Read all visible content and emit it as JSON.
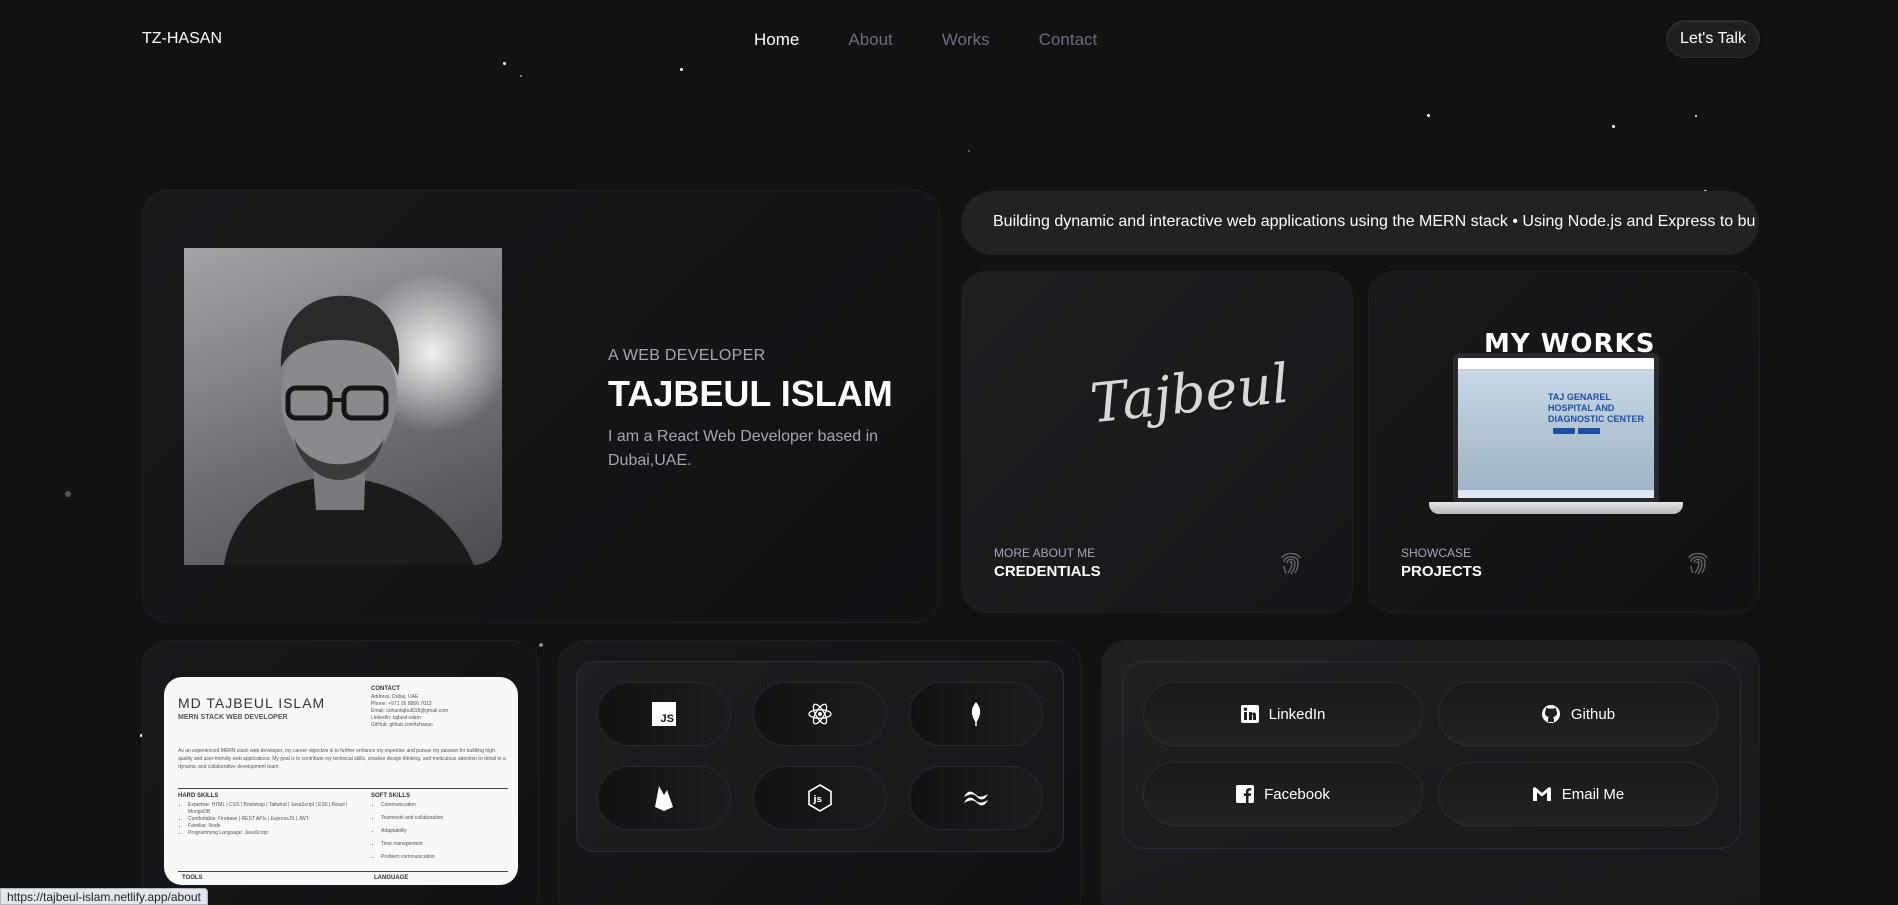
{
  "nav": {
    "logo": "TZ-HASAN",
    "items": [
      {
        "label": "Home",
        "active": true
      },
      {
        "label": "About",
        "active": false
      },
      {
        "label": "Works",
        "active": false
      },
      {
        "label": "Contact",
        "active": false
      }
    ],
    "cta": "Let's Talk"
  },
  "hero": {
    "subtitle": "A WEB DEVELOPER",
    "name": "TAJBEUL ISLAM",
    "description": "I am a React Web Developer based in Dubai,UAE."
  },
  "marquee": "Building dynamic and interactive web applications using the MERN stack • Using Node.js and Express to build e",
  "credentials": {
    "signature": "Tajbeul",
    "label": "MORE ABOUT ME",
    "title": "CREDENTIALS"
  },
  "projects": {
    "image_heading": "MY WORKS",
    "screen_text": "TAJ GENAREL HOSPITAL AND DIAGNOSTIC CENTER",
    "label": "SHOWCASE",
    "title": "PROJECTS"
  },
  "resume": {
    "name": "MD TAJBEUL ISLAM",
    "role": "MERN STACK WEB DEVELOPER",
    "contact_heading": "CONTACT",
    "contact_lines": [
      "Address: Dubai, UAE",
      "Phone: +971 05 8866 7013",
      "Email: sohantajbul018@gmail.com",
      "LinkedIn: tajbeul-islam",
      "GitHub: github.com/tzhasan"
    ],
    "summary": "As an experienced MERN stack web developer, my career objective is to further enhance my expertise and pursue my passion for building high-quality and user-friendly web applications. My goal is to contribute my technical skills, creative design thinking, and meticulous attention to detail to a dynamic and collaborative development team.",
    "hard_heading": "HARD SKILLS",
    "hard_skills": [
      "Expertise: HTML | CSS | Bootstrap | Tailwind | JavaScript | ES6 | React | MongoDB",
      "Comfortable: Firebase | REST APIs | ExpressJS | JWT",
      "Familiar: Node",
      "Programming Language: JavaScript"
    ],
    "soft_heading": "SOFT SKILLS",
    "soft_skills": [
      "Communication",
      "Teamwork and collaboration",
      "Adaptability",
      "Time management",
      "Problem communication"
    ],
    "tools_heading": "TOOLS",
    "language_heading": "LANGUAGE"
  },
  "tech": [
    {
      "icon": "javascript-icon",
      "text": "JS"
    },
    {
      "icon": "react-icon"
    },
    {
      "icon": "mongodb-icon"
    },
    {
      "icon": "firebase-icon"
    },
    {
      "icon": "nodejs-icon"
    },
    {
      "icon": "tailwind-icon"
    }
  ],
  "social": [
    {
      "label": "LinkedIn",
      "icon": "linkedin-icon"
    },
    {
      "label": "Github",
      "icon": "github-icon"
    },
    {
      "label": "Facebook",
      "icon": "facebook-icon"
    },
    {
      "label": "Email Me",
      "icon": "gmail-icon"
    }
  ],
  "status_url": "https://tajbeul-islam.netlify.app/about",
  "colors": {
    "background": "#121214",
    "muted_text": "#a3a7b4",
    "nav_inactive": "#6b6d78",
    "card_border": "#1c1f2a"
  }
}
